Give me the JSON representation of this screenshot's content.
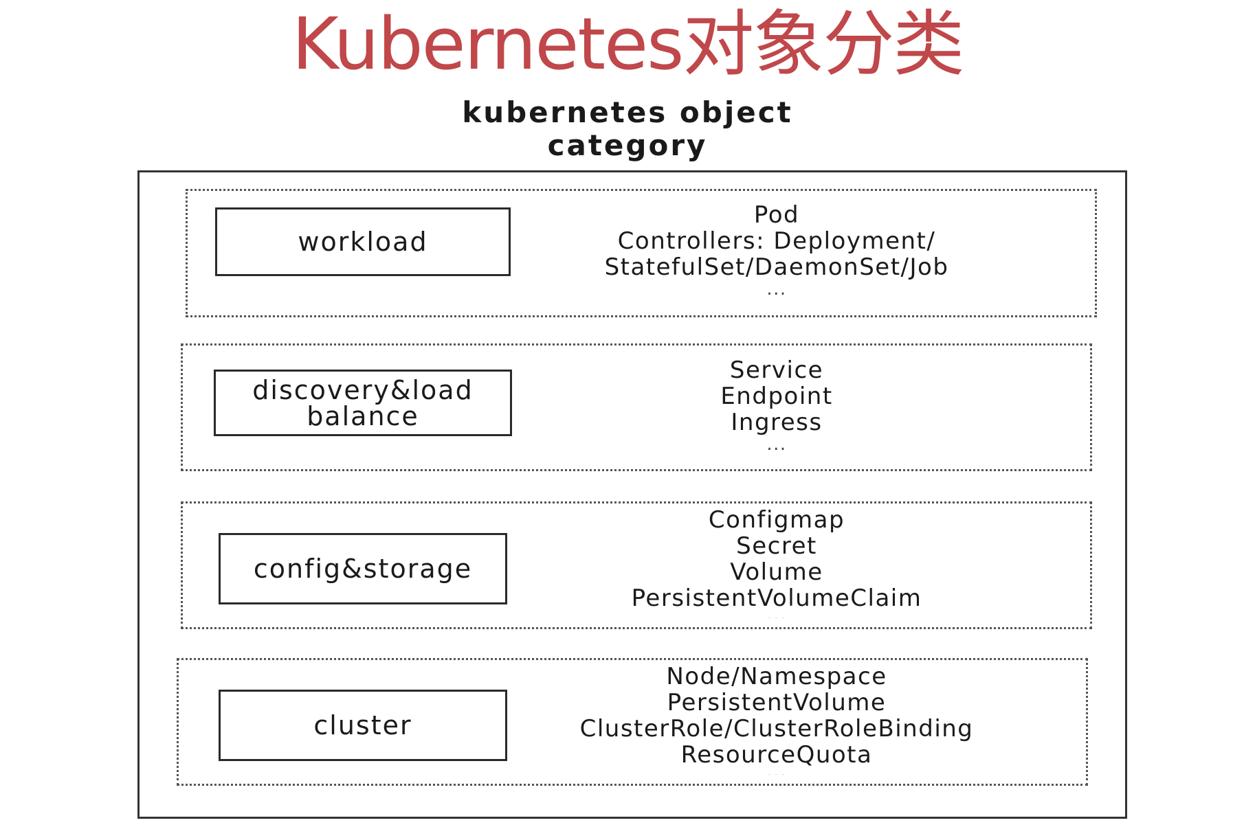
{
  "page_title": "Kubernetes对象分类",
  "diagram": {
    "title_line1": "kubernetes object",
    "title_line2": "category",
    "groups": [
      {
        "category_lines": [
          "workload"
        ],
        "objects": [
          "Pod",
          "Controllers: Deployment/",
          "StatefulSet/DaemonSet/Job",
          "..."
        ]
      },
      {
        "category_lines": [
          "discovery&load",
          "balance"
        ],
        "objects": [
          "Service",
          "Endpoint",
          "Ingress",
          "..."
        ]
      },
      {
        "category_lines": [
          "config&storage"
        ],
        "objects": [
          "Configmap",
          "Secret",
          "Volume",
          "PersistentVolumeClaim",
          "..."
        ]
      },
      {
        "category_lines": [
          "cluster"
        ],
        "objects": [
          "Node/Namespace",
          "PersistentVolume",
          "ClusterRole/ClusterRoleBinding",
          "ResourceQuota",
          "..."
        ]
      }
    ]
  },
  "colors": {
    "title": "#c0474a",
    "text": "#1a1a1a",
    "frame": "#333333"
  }
}
